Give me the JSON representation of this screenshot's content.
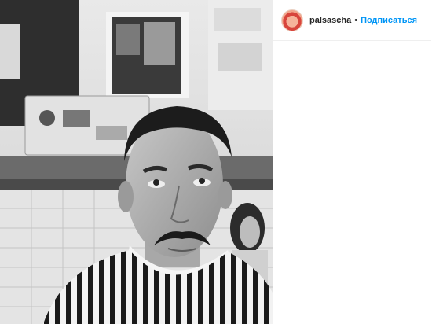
{
  "post": {
    "photo_description_icon": "portrait-photo",
    "colors": {
      "follow": "#0095f6",
      "username": "#262626",
      "border": "#dbdbdb"
    }
  },
  "header": {
    "username": "palsascha",
    "separator": "•",
    "follow_label": "Подписаться"
  }
}
